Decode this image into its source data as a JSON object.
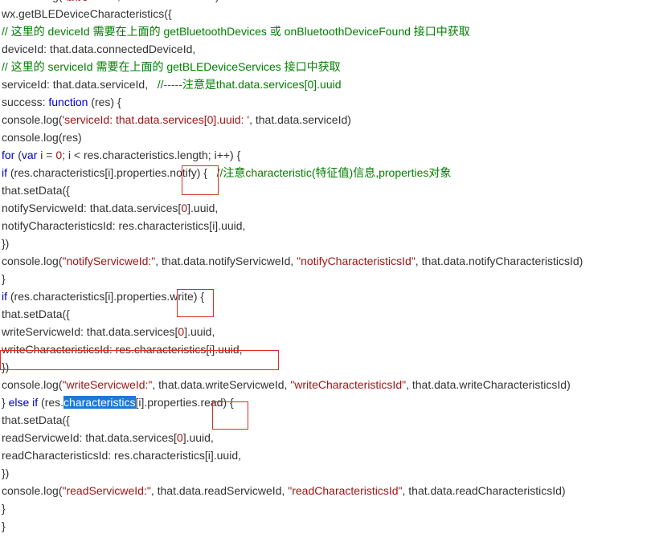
{
  "code_lines": [
    {
      "segments": [
        {
          "t": "console.log(",
          "c": ""
        },
        {
          "t": "\"服务uuid:\"",
          "c": "str"
        },
        {
          "t": ", that.data.serviceId)",
          "c": ""
        }
      ]
    },
    {
      "segments": [
        {
          "t": "wx.getBLEDeviceCharacteristics({",
          "c": ""
        }
      ]
    },
    {
      "segments": [
        {
          "t": "// 这里的 deviceId 需要在上面的 getBluetoothDevices 或 onBluetoothDeviceFound 接口中获取",
          "c": "cm"
        }
      ]
    },
    {
      "segments": [
        {
          "t": "deviceId: that.data.connectedDeviceId,",
          "c": ""
        }
      ]
    },
    {
      "segments": [
        {
          "t": "// 这里的 serviceId 需要在上面的 getBLEDeviceServices 接口中获取",
          "c": "cm"
        }
      ]
    },
    {
      "segments": [
        {
          "t": "serviceId: that.data.serviceId,   ",
          "c": ""
        },
        {
          "t": "//-----注意是that.data.services[0].uuid",
          "c": "cm"
        }
      ]
    },
    {
      "segments": [
        {
          "t": "success: ",
          "c": ""
        },
        {
          "t": "function",
          "c": "kw"
        },
        {
          "t": " (res) {",
          "c": ""
        }
      ]
    },
    {
      "segments": [
        {
          "t": "console.log(",
          "c": ""
        },
        {
          "t": "'serviceId: that.data.services[0].uuid: '",
          "c": "str"
        },
        {
          "t": ", that.data.serviceId)",
          "c": ""
        }
      ]
    },
    {
      "segments": [
        {
          "t": "console.log(res)",
          "c": ""
        }
      ]
    },
    {
      "segments": [
        {
          "t": "for",
          "c": "kw"
        },
        {
          "t": " (",
          "c": ""
        },
        {
          "t": "var",
          "c": "kw"
        },
        {
          "t": " i = ",
          "c": ""
        },
        {
          "t": "0",
          "c": "num"
        },
        {
          "t": "; i < res.characteristics.length; i++) {",
          "c": ""
        }
      ]
    },
    {
      "segments": [
        {
          "t": "if",
          "c": "kw"
        },
        {
          "t": " (res.characteristics[i].properties.notify) {   ",
          "c": ""
        },
        {
          "t": "//注意characteristic(特征值)信息,properties对象",
          "c": "cm"
        }
      ]
    },
    {
      "segments": [
        {
          "t": "that.setData({",
          "c": ""
        }
      ]
    },
    {
      "segments": [
        {
          "t": "notifyServicweId: that.data.services[",
          "c": ""
        },
        {
          "t": "0",
          "c": "num"
        },
        {
          "t": "].uuid,",
          "c": ""
        }
      ]
    },
    {
      "segments": [
        {
          "t": "notifyCharacteristicsId: res.characteristics[i].uuid,",
          "c": ""
        }
      ]
    },
    {
      "segments": [
        {
          "t": "})",
          "c": ""
        }
      ]
    },
    {
      "segments": [
        {
          "t": "console.log(",
          "c": ""
        },
        {
          "t": "\"notifyServicweId:\"",
          "c": "str"
        },
        {
          "t": ", that.data.notifyServicweId, ",
          "c": ""
        },
        {
          "t": "\"notifyCharacteristicsId\"",
          "c": "str"
        },
        {
          "t": ", that.data.notifyCharacteristicsId)",
          "c": ""
        }
      ]
    },
    {
      "segments": [
        {
          "t": "}",
          "c": ""
        }
      ]
    },
    {
      "segments": [
        {
          "t": "if",
          "c": "kw"
        },
        {
          "t": " (res.characteristics[i].properties.write) {",
          "c": ""
        }
      ]
    },
    {
      "segments": [
        {
          "t": "that.setData({",
          "c": ""
        }
      ]
    },
    {
      "segments": [
        {
          "t": "writeServicweId: that.data.services[",
          "c": ""
        },
        {
          "t": "0",
          "c": "num"
        },
        {
          "t": "].uuid,",
          "c": ""
        }
      ]
    },
    {
      "segments": [
        {
          "t": "writeCharacteristicsId: res.characteristics[i].uuid,",
          "c": ""
        }
      ]
    },
    {
      "segments": [
        {
          "t": "})",
          "c": ""
        }
      ]
    },
    {
      "segments": [
        {
          "t": "console.log(",
          "c": ""
        },
        {
          "t": "\"writeServicweId:\"",
          "c": "str"
        },
        {
          "t": ", that.data.writeServicweId, ",
          "c": ""
        },
        {
          "t": "\"writeCharacteristicsId\"",
          "c": "str"
        },
        {
          "t": ", that.data.writeCharacteristicsId)",
          "c": ""
        }
      ]
    },
    {
      "segments": [
        {
          "t": "} ",
          "c": ""
        },
        {
          "t": "else if",
          "c": "kw"
        },
        {
          "t": " (res.",
          "c": ""
        },
        {
          "t": "characteristics",
          "c": "sel"
        },
        {
          "t": "[i].properties.read) {",
          "c": ""
        }
      ]
    },
    {
      "segments": [
        {
          "t": "that.setData({",
          "c": ""
        }
      ]
    },
    {
      "segments": [
        {
          "t": "readServicweId: that.data.services[",
          "c": ""
        },
        {
          "t": "0",
          "c": "num"
        },
        {
          "t": "].uuid,",
          "c": ""
        }
      ]
    },
    {
      "segments": [
        {
          "t": "readCharacteristicsId: res.characteristics[i].uuid,",
          "c": ""
        }
      ]
    },
    {
      "segments": [
        {
          "t": "})",
          "c": ""
        }
      ]
    },
    {
      "segments": [
        {
          "t": "console.log(",
          "c": ""
        },
        {
          "t": "\"readServicweId:\"",
          "c": "str"
        },
        {
          "t": ", that.data.readServicweId, ",
          "c": ""
        },
        {
          "t": "\"readCharacteristicsId\"",
          "c": "str"
        },
        {
          "t": ", that.data.readCharacteristicsId)",
          "c": ""
        }
      ]
    },
    {
      "segments": [
        {
          "t": "}",
          "c": ""
        }
      ]
    },
    {
      "segments": [
        {
          "t": "}",
          "c": ""
        }
      ]
    }
  ],
  "colors": {
    "text": "#333333",
    "keyword": "#0000cc",
    "string": "#a31515",
    "comment": "#008000",
    "selection": "#1e78d6",
    "annotation_box": "#d93025"
  }
}
